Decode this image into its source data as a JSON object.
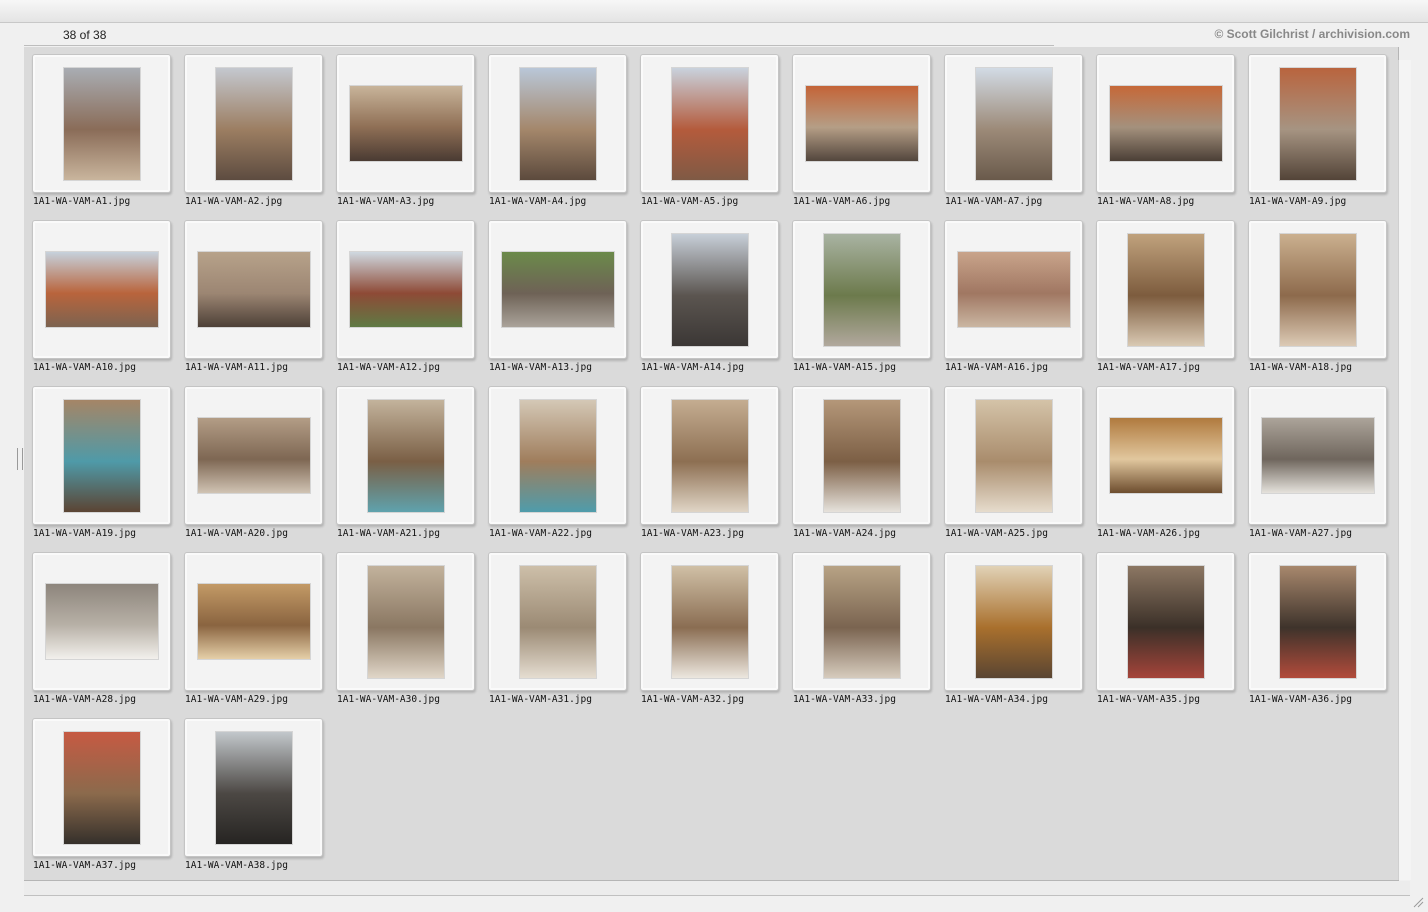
{
  "header": {
    "count": "38 of 38",
    "copyright": "© Scott Gilchrist / archivision.com"
  },
  "images": [
    {
      "name": "1A1-WA-VAM-A1.jpg",
      "orientation": "portrait",
      "colors": [
        "#a9adb3",
        "#8a6c58",
        "#c9b59d"
      ]
    },
    {
      "name": "1A1-WA-VAM-A2.jpg",
      "orientation": "portrait",
      "colors": [
        "#c4c8cf",
        "#9c7e62",
        "#5d4c40"
      ]
    },
    {
      "name": "1A1-WA-VAM-A3.jpg",
      "orientation": "landscape",
      "colors": [
        "#c8b49a",
        "#8f6f55",
        "#4a3b33"
      ]
    },
    {
      "name": "1A1-WA-VAM-A4.jpg",
      "orientation": "portrait",
      "colors": [
        "#b9c7d8",
        "#a4876b",
        "#5c4a3d"
      ]
    },
    {
      "name": "1A1-WA-VAM-A5.jpg",
      "orientation": "portrait",
      "colors": [
        "#c9d2dd",
        "#b45b3c",
        "#7f5a45"
      ]
    },
    {
      "name": "1A1-WA-VAM-A6.jpg",
      "orientation": "landscape",
      "colors": [
        "#c46437",
        "#b59e86",
        "#53463d"
      ]
    },
    {
      "name": "1A1-WA-VAM-A7.jpg",
      "orientation": "portrait",
      "colors": [
        "#d2dbe5",
        "#9c8a78",
        "#6a5a4b"
      ]
    },
    {
      "name": "1A1-WA-VAM-A8.jpg",
      "orientation": "landscape",
      "colors": [
        "#c66838",
        "#a4917d",
        "#4b3f36"
      ]
    },
    {
      "name": "1A1-WA-VAM-A9.jpg",
      "orientation": "portrait",
      "colors": [
        "#b9643e",
        "#a69482",
        "#534438"
      ]
    },
    {
      "name": "1A1-WA-VAM-A10.jpg",
      "orientation": "landscape",
      "colors": [
        "#c6d1dc",
        "#b9643c",
        "#7c6350"
      ]
    },
    {
      "name": "1A1-WA-VAM-A11.jpg",
      "orientation": "landscape",
      "colors": [
        "#b7a28a",
        "#9c8673",
        "#4d4037"
      ]
    },
    {
      "name": "1A1-WA-VAM-A12.jpg",
      "orientation": "landscape",
      "colors": [
        "#cfd8e0",
        "#8e4a36",
        "#5f7a44"
      ]
    },
    {
      "name": "1A1-WA-VAM-A13.jpg",
      "orientation": "landscape",
      "colors": [
        "#6b8a4a",
        "#6e6256",
        "#aaa39a"
      ]
    },
    {
      "name": "1A1-WA-VAM-A14.jpg",
      "orientation": "portrait",
      "colors": [
        "#c7cfd8",
        "#5b5550",
        "#3b3735"
      ]
    },
    {
      "name": "1A1-WA-VAM-A15.jpg",
      "orientation": "portrait",
      "colors": [
        "#a9b3a2",
        "#6c7a4c",
        "#b1a89d"
      ]
    },
    {
      "name": "1A1-WA-VAM-A16.jpg",
      "orientation": "landscape",
      "colors": [
        "#c9a48b",
        "#a07762",
        "#cab6a2"
      ]
    },
    {
      "name": "1A1-WA-VAM-A17.jpg",
      "orientation": "portrait",
      "colors": [
        "#c0a27d",
        "#7d5c3e",
        "#d9c9b3"
      ]
    },
    {
      "name": "1A1-WA-VAM-A18.jpg",
      "orientation": "portrait",
      "colors": [
        "#cbb08f",
        "#8d6a4c",
        "#dccab5"
      ]
    },
    {
      "name": "1A1-WA-VAM-A19.jpg",
      "orientation": "portrait",
      "colors": [
        "#a58566",
        "#4f9aa8",
        "#5b4433"
      ]
    },
    {
      "name": "1A1-WA-VAM-A20.jpg",
      "orientation": "landscape",
      "colors": [
        "#b39d86",
        "#7e6753",
        "#d0c3b3"
      ]
    },
    {
      "name": "1A1-WA-VAM-A21.jpg",
      "orientation": "portrait",
      "colors": [
        "#c3b39c",
        "#7a5f45",
        "#5fa2ad"
      ]
    },
    {
      "name": "1A1-WA-VAM-A22.jpg",
      "orientation": "portrait",
      "colors": [
        "#d4c8b6",
        "#9f7d5c",
        "#4f9cab"
      ]
    },
    {
      "name": "1A1-WA-VAM-A23.jpg",
      "orientation": "portrait",
      "colors": [
        "#c4ad91",
        "#8d6f52",
        "#e0d5c6"
      ]
    },
    {
      "name": "1A1-WA-VAM-A24.jpg",
      "orientation": "portrait",
      "colors": [
        "#b49779",
        "#7c5f45",
        "#e6e2dc"
      ]
    },
    {
      "name": "1A1-WA-VAM-A25.jpg",
      "orientation": "portrait",
      "colors": [
        "#d4c3a8",
        "#a98c6c",
        "#e6dccd"
      ]
    },
    {
      "name": "1A1-WA-VAM-A26.jpg",
      "orientation": "landscape",
      "colors": [
        "#b07a3e",
        "#e1c79e",
        "#6d4d2e"
      ]
    },
    {
      "name": "1A1-WA-VAM-A27.jpg",
      "orientation": "landscape",
      "colors": [
        "#aca49a",
        "#6f665d",
        "#e5e2dc"
      ]
    },
    {
      "name": "1A1-WA-VAM-A28.jpg",
      "orientation": "landscape",
      "colors": [
        "#8d857c",
        "#b8b1a7",
        "#f2f0ec"
      ]
    },
    {
      "name": "1A1-WA-VAM-A29.jpg",
      "orientation": "landscape",
      "colors": [
        "#c39a66",
        "#8a6440",
        "#e5cfa8"
      ]
    },
    {
      "name": "1A1-WA-VAM-A30.jpg",
      "orientation": "portrait",
      "colors": [
        "#c2b29c",
        "#8a7762",
        "#e0d6c8"
      ]
    },
    {
      "name": "1A1-WA-VAM-A31.jpg",
      "orientation": "portrait",
      "colors": [
        "#cdbfa9",
        "#9b8a74",
        "#e5ddd1"
      ]
    },
    {
      "name": "1A1-WA-VAM-A32.jpg",
      "orientation": "portrait",
      "colors": [
        "#d0c0a6",
        "#8a6d52",
        "#ece7df"
      ]
    },
    {
      "name": "1A1-WA-VAM-A33.jpg",
      "orientation": "portrait",
      "colors": [
        "#b8a385",
        "#7a6450",
        "#d6cbbd"
      ]
    },
    {
      "name": "1A1-WA-VAM-A34.jpg",
      "orientation": "portrait",
      "colors": [
        "#e1d2b6",
        "#a9702d",
        "#5a4532"
      ]
    },
    {
      "name": "1A1-WA-VAM-A35.jpg",
      "orientation": "portrait",
      "colors": [
        "#8c7763",
        "#3b3028",
        "#a5443a"
      ]
    },
    {
      "name": "1A1-WA-VAM-A36.jpg",
      "orientation": "portrait",
      "colors": [
        "#a8886d",
        "#3e332b",
        "#b24b3b"
      ]
    },
    {
      "name": "1A1-WA-VAM-A37.jpg",
      "orientation": "portrait",
      "colors": [
        "#c65a43",
        "#8b6a4c",
        "#35302b"
      ]
    },
    {
      "name": "1A1-WA-VAM-A38.jpg",
      "orientation": "portrait",
      "colors": [
        "#c2c7cb",
        "#4c4844",
        "#262422"
      ]
    }
  ]
}
